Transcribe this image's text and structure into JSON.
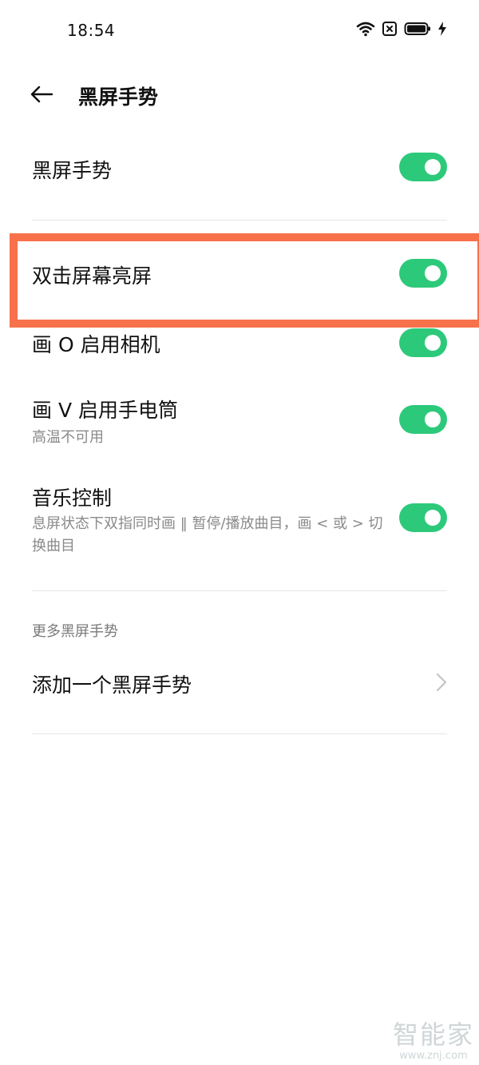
{
  "status_bar": {
    "time": "18:54",
    "icons": [
      "wifi-icon",
      "sim-off-icon",
      "battery-icon",
      "charging-icon"
    ],
    "battery_level": 0.85
  },
  "header": {
    "back_icon": "back-arrow-icon",
    "title": "黑屏手势"
  },
  "settings": [
    {
      "title": "黑屏手势",
      "enabled": true
    },
    {
      "title": "双击屏幕亮屏",
      "enabled": true,
      "highlighted": true
    },
    {
      "title": "画 O 启用相机",
      "enabled": true
    },
    {
      "title": "画 V 启用手电筒",
      "subtitle": "高温不可用",
      "enabled": true
    },
    {
      "title": "音乐控制",
      "subtitle": "息屏状态下双指同时画 ‖ 暂停/播放曲目，画 < 或 > 切换曲目",
      "enabled": true
    }
  ],
  "more_section": {
    "label": "更多黑屏手势",
    "add_item": "添加一个黑屏手势",
    "chevron_icon": "chevron-right-icon"
  },
  "watermark": {
    "brand": "智能家",
    "url": "www.znj.com"
  },
  "colors": {
    "toggle_on": "#2dc97a",
    "highlight": "#f7714a",
    "divider": "#e6e6e6",
    "secondary_text": "#8a8a8a"
  }
}
